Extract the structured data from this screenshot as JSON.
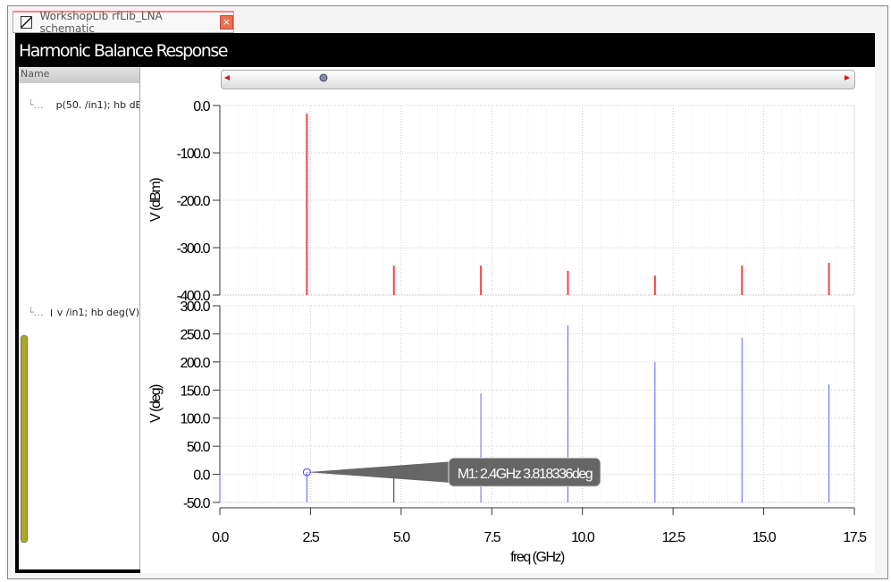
{
  "tab": {
    "title": "WorkshopLib rfLib_LNA schematic",
    "close": "×"
  },
  "window": {
    "title": "Harmonic Balance Response"
  },
  "legend": {
    "header": "Name",
    "items": [
      {
        "label": "p(50. /in1); hb dB",
        "color": "#e00000"
      },
      {
        "label": "v /in1; hb deg(V)",
        "color": "#0000e0"
      }
    ]
  },
  "marker": {
    "label": "M1: 2.4GHz 3.818336deg",
    "x": 2.4,
    "y": 3.818336
  },
  "chart_data": [
    {
      "type": "bar",
      "title": "",
      "xlabel": "freq (GHz)",
      "ylabel": "V (dBm)",
      "xlim": [
        0,
        17.5
      ],
      "ylim": [
        -400,
        0
      ],
      "yticks": [
        "0.0",
        "-100.0",
        "-200.0",
        "-300.0",
        "-400.0"
      ],
      "color": "#ff4040",
      "x": [
        2.4,
        4.8,
        7.2,
        9.6,
        12.0,
        14.4,
        16.8
      ],
      "values": [
        -17,
        -338,
        -338,
        -349,
        -359,
        -338,
        -332
      ]
    },
    {
      "type": "bar",
      "title": "",
      "xlabel": "freq (GHz)",
      "ylabel": "V (deg)",
      "xlim": [
        0,
        17.5
      ],
      "ylim": [
        -50,
        300
      ],
      "yticks": [
        "300.0",
        "250.0",
        "200.0",
        "150.0",
        "100.0",
        "50.0",
        "0.0",
        "-50.0"
      ],
      "color": "#6060ff",
      "x": [
        0,
        2.4,
        4.8,
        7.2,
        9.6,
        12.0,
        14.4,
        16.8
      ],
      "values": [
        0,
        3.818,
        14,
        144,
        265,
        200,
        243,
        160
      ]
    }
  ],
  "xticks": [
    "0.0",
    "2.5",
    "5.0",
    "7.5",
    "10.0",
    "12.5",
    "15.0",
    "17.5"
  ]
}
